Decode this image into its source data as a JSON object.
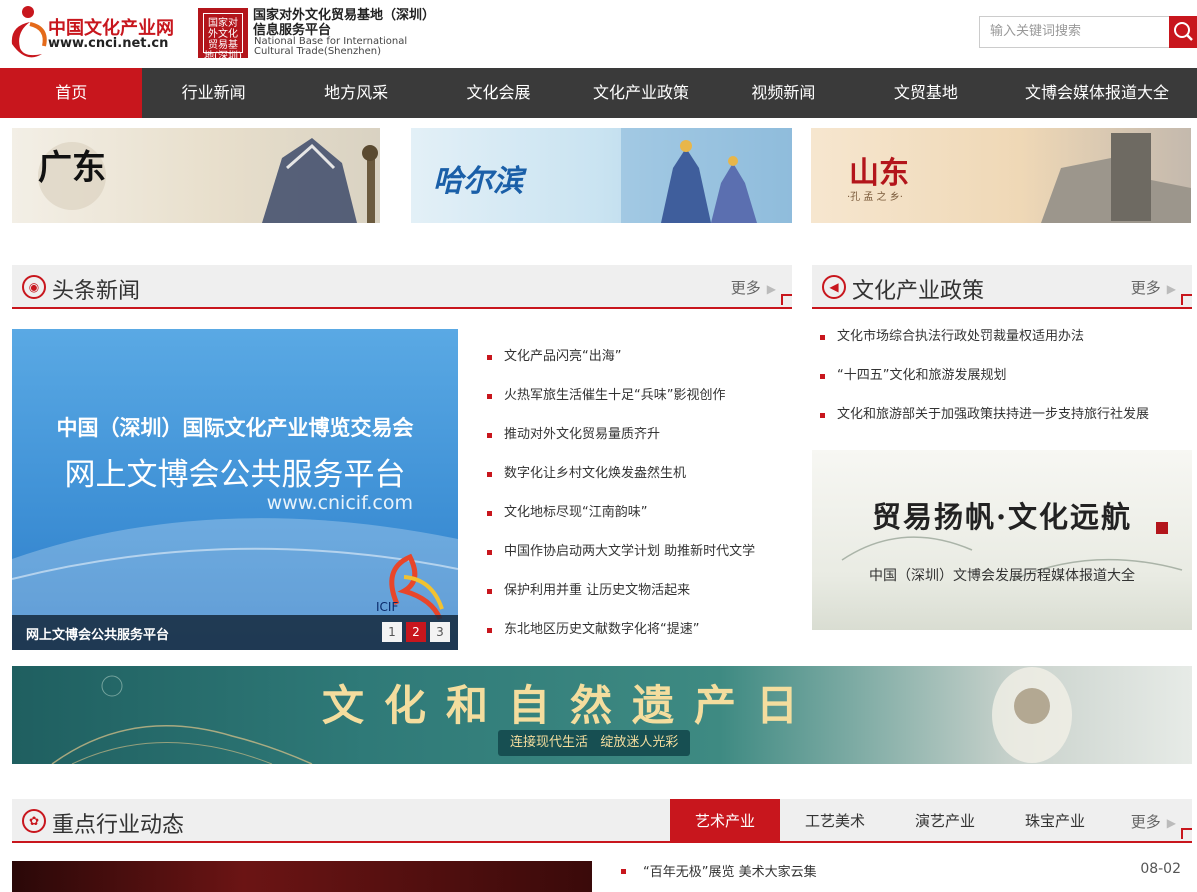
{
  "header": {
    "logo_cn": "中国文化产业网",
    "logo_url": "www.cnci.net.cn",
    "seal_text": "国家对外文化贸易基地(深圳)",
    "base_title_1": "国家对外文化贸易基地（深圳）",
    "base_title_2": "信息服务平台",
    "base_en_1": "National Base for International",
    "base_en_2": "Cultural Trade(Shenzhen)",
    "search_placeholder": "输入关键词搜索",
    "search_icon": "search-icon"
  },
  "nav": {
    "items": [
      "首页",
      "行业新闻",
      "地方风采",
      "文化会展",
      "文化产业政策",
      "视频新闻",
      "文贸基地",
      "文博会媒体报道大全"
    ],
    "active_index": 0
  },
  "banners": {
    "guangdong": "广东",
    "harbin": "哈尔滨",
    "shandong": "山东",
    "shandong_sub": "·孔 孟 之 乡·"
  },
  "headline": {
    "title": "头条新闻",
    "more": "更多",
    "slide": {
      "line1": "中国（深圳）国际文化产业博览交易会",
      "line2": "网上文博会公共服务平台",
      "url": "www.cnicif.com",
      "logo_text": "ICIF",
      "caption": "网上文博会公共服务平台",
      "pages": [
        "1",
        "2",
        "3"
      ],
      "active_page": 1
    },
    "news": [
      "文化产品闪亮“出海”",
      "火热军旅生活催生十足“兵味”影视创作",
      "推动对外文化贸易量质齐升",
      "数字化让乡村文化焕发盎然生机",
      "文化地标尽现“江南韵味”",
      "中国作协启动两大文学计划 助推新时代文学",
      "保护利用并重 让历史文物活起来",
      "东北地区历史文献数字化将“提速”"
    ]
  },
  "policy": {
    "title": "文化产业政策",
    "more": "更多",
    "items": [
      "文化市场综合执法行政处罚裁量权适用办法",
      "“十四五”文化和旅游发展规划",
      "文化和旅游部关于加强政策扶持进一步支持旅行社发展"
    ],
    "trade_title": "贸易扬帆·文化远航",
    "trade_sub": "中国（深圳）文博会发展历程媒体报道大全"
  },
  "heritage": {
    "title": "文化和自然遗产日",
    "sub_1": "连接现代生活",
    "sub_2": "绽放迷人光彩"
  },
  "industry": {
    "title": "重点行业动态",
    "tabs": [
      "艺术产业",
      "工艺美术",
      "演艺产业",
      "珠宝产业"
    ],
    "active_tab": 0,
    "more": "更多",
    "latest": {
      "title": "“百年无极”展览 美术大家云集",
      "date": "08-02"
    }
  },
  "colors": {
    "brand_red": "#c8161d",
    "nav_bg": "#3a3a3a"
  }
}
